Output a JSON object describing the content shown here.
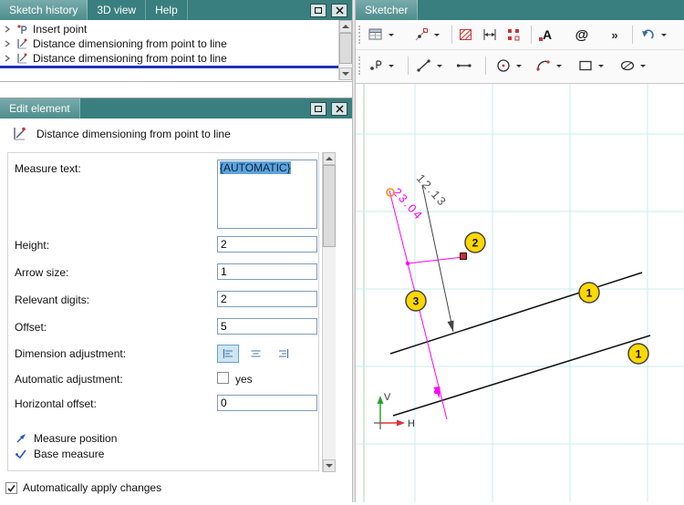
{
  "colors": {
    "titlebar_teal": "#3A7F7F",
    "selection_blue": "#2233BB",
    "badge_yellow": "#FFD800",
    "magenta": "#FF00FF",
    "grid_cyan": "#C9EDED",
    "axis_green": "#2CA02C",
    "axis_red": "#DD3333",
    "text_selection": "#5FA3DC"
  },
  "sketch_history": {
    "tabs": [
      {
        "label": "Sketch history",
        "active": true
      },
      {
        "label": "3D view",
        "active": false
      },
      {
        "label": "Help",
        "active": false
      }
    ],
    "items": [
      {
        "icon": "insert-point-icon",
        "label": "Insert point",
        "selected": false
      },
      {
        "icon": "dimension-icon",
        "label": "Distance dimensioning from point to line",
        "selected": false
      },
      {
        "icon": "dimension-icon",
        "label": "Distance dimensioning from point to line",
        "selected": true
      }
    ]
  },
  "edit_element": {
    "title": "Edit element",
    "header": {
      "icon": "dimension-icon",
      "label": "Distance dimensioning from point to line"
    },
    "fields": {
      "measure_text": {
        "label": "Measure text:",
        "value": "{AUTOMATIC}",
        "text_selected": true
      },
      "height": {
        "label": "Height:",
        "value": "2"
      },
      "arrow_size": {
        "label": "Arrow size:",
        "value": "1"
      },
      "relevant_digits": {
        "label": "Relevant digits:",
        "value": "2"
      },
      "offset": {
        "label": "Offset:",
        "value": "5"
      },
      "dimension_adjustment": {
        "label": "Dimension adjustment:",
        "options": [
          "align-left",
          "align-center",
          "align-right"
        ],
        "selected": "align-left"
      },
      "automatic_adjustment": {
        "label": "Automatic adjustment:",
        "checkbox_label": "yes",
        "checked": false
      },
      "horizontal_offset": {
        "label": "Horizontal offset:",
        "value": "0"
      }
    },
    "legend": [
      {
        "icon": "measure-position-icon",
        "label": "Measure position"
      },
      {
        "icon": "base-measure-icon",
        "label": "Base measure"
      }
    ],
    "apply": {
      "label": "Automatically apply changes",
      "checked": true
    }
  },
  "sketcher": {
    "tab": "Sketcher",
    "toolbar": {
      "row1_icons": [
        "selection-grid",
        "snap-settings",
        "hatch",
        "distance-constraint",
        "point-pattern",
        "text",
        "attribute-at",
        "overflow",
        "undo"
      ],
      "row2_icons": [
        "point",
        "line",
        "polyline",
        "circle",
        "arc",
        "rectangle",
        "ellipse"
      ],
      "text_glyph": "A",
      "at_glyph": "@",
      "overflow_glyph": "»"
    },
    "canvas": {
      "dimension_labels": [
        {
          "text": "12.13",
          "color": "#555555"
        },
        {
          "text": "23.04",
          "color": "#FF00FF"
        }
      ],
      "badges": [
        {
          "text": "1"
        },
        {
          "text": "1"
        },
        {
          "text": "2"
        },
        {
          "text": "3"
        }
      ],
      "axes": {
        "vertical": "V",
        "horizontal": "H"
      }
    }
  }
}
